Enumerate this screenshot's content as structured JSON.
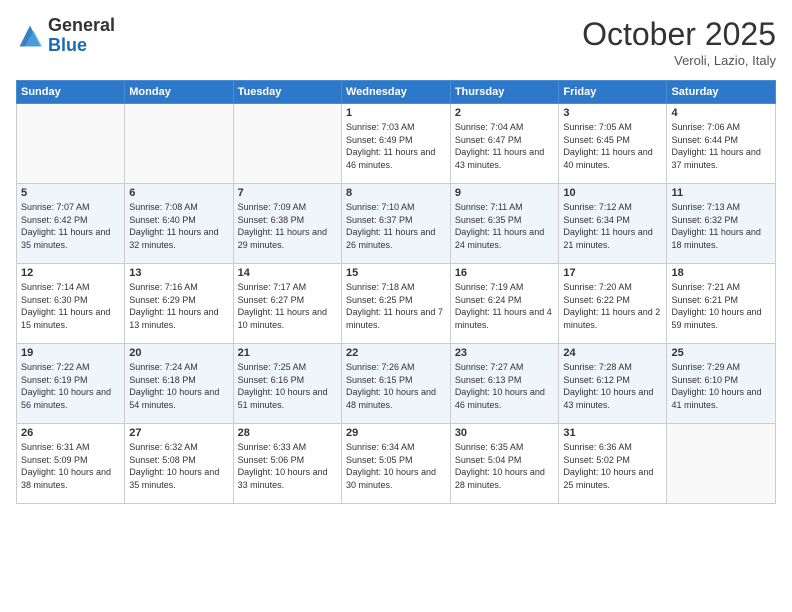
{
  "header": {
    "logo_general": "General",
    "logo_blue": "Blue",
    "month_title": "October 2025",
    "subtitle": "Veroli, Lazio, Italy"
  },
  "days_of_week": [
    "Sunday",
    "Monday",
    "Tuesday",
    "Wednesday",
    "Thursday",
    "Friday",
    "Saturday"
  ],
  "weeks": [
    [
      {
        "day": "",
        "info": ""
      },
      {
        "day": "",
        "info": ""
      },
      {
        "day": "",
        "info": ""
      },
      {
        "day": "1",
        "info": "Sunrise: 7:03 AM\nSunset: 6:49 PM\nDaylight: 11 hours and 46 minutes."
      },
      {
        "day": "2",
        "info": "Sunrise: 7:04 AM\nSunset: 6:47 PM\nDaylight: 11 hours and 43 minutes."
      },
      {
        "day": "3",
        "info": "Sunrise: 7:05 AM\nSunset: 6:45 PM\nDaylight: 11 hours and 40 minutes."
      },
      {
        "day": "4",
        "info": "Sunrise: 7:06 AM\nSunset: 6:44 PM\nDaylight: 11 hours and 37 minutes."
      }
    ],
    [
      {
        "day": "5",
        "info": "Sunrise: 7:07 AM\nSunset: 6:42 PM\nDaylight: 11 hours and 35 minutes."
      },
      {
        "day": "6",
        "info": "Sunrise: 7:08 AM\nSunset: 6:40 PM\nDaylight: 11 hours and 32 minutes."
      },
      {
        "day": "7",
        "info": "Sunrise: 7:09 AM\nSunset: 6:38 PM\nDaylight: 11 hours and 29 minutes."
      },
      {
        "day": "8",
        "info": "Sunrise: 7:10 AM\nSunset: 6:37 PM\nDaylight: 11 hours and 26 minutes."
      },
      {
        "day": "9",
        "info": "Sunrise: 7:11 AM\nSunset: 6:35 PM\nDaylight: 11 hours and 24 minutes."
      },
      {
        "day": "10",
        "info": "Sunrise: 7:12 AM\nSunset: 6:34 PM\nDaylight: 11 hours and 21 minutes."
      },
      {
        "day": "11",
        "info": "Sunrise: 7:13 AM\nSunset: 6:32 PM\nDaylight: 11 hours and 18 minutes."
      }
    ],
    [
      {
        "day": "12",
        "info": "Sunrise: 7:14 AM\nSunset: 6:30 PM\nDaylight: 11 hours and 15 minutes."
      },
      {
        "day": "13",
        "info": "Sunrise: 7:16 AM\nSunset: 6:29 PM\nDaylight: 11 hours and 13 minutes."
      },
      {
        "day": "14",
        "info": "Sunrise: 7:17 AM\nSunset: 6:27 PM\nDaylight: 11 hours and 10 minutes."
      },
      {
        "day": "15",
        "info": "Sunrise: 7:18 AM\nSunset: 6:25 PM\nDaylight: 11 hours and 7 minutes."
      },
      {
        "day": "16",
        "info": "Sunrise: 7:19 AM\nSunset: 6:24 PM\nDaylight: 11 hours and 4 minutes."
      },
      {
        "day": "17",
        "info": "Sunrise: 7:20 AM\nSunset: 6:22 PM\nDaylight: 11 hours and 2 minutes."
      },
      {
        "day": "18",
        "info": "Sunrise: 7:21 AM\nSunset: 6:21 PM\nDaylight: 10 hours and 59 minutes."
      }
    ],
    [
      {
        "day": "19",
        "info": "Sunrise: 7:22 AM\nSunset: 6:19 PM\nDaylight: 10 hours and 56 minutes."
      },
      {
        "day": "20",
        "info": "Sunrise: 7:24 AM\nSunset: 6:18 PM\nDaylight: 10 hours and 54 minutes."
      },
      {
        "day": "21",
        "info": "Sunrise: 7:25 AM\nSunset: 6:16 PM\nDaylight: 10 hours and 51 minutes."
      },
      {
        "day": "22",
        "info": "Sunrise: 7:26 AM\nSunset: 6:15 PM\nDaylight: 10 hours and 48 minutes."
      },
      {
        "day": "23",
        "info": "Sunrise: 7:27 AM\nSunset: 6:13 PM\nDaylight: 10 hours and 46 minutes."
      },
      {
        "day": "24",
        "info": "Sunrise: 7:28 AM\nSunset: 6:12 PM\nDaylight: 10 hours and 43 minutes."
      },
      {
        "day": "25",
        "info": "Sunrise: 7:29 AM\nSunset: 6:10 PM\nDaylight: 10 hours and 41 minutes."
      }
    ],
    [
      {
        "day": "26",
        "info": "Sunrise: 6:31 AM\nSunset: 5:09 PM\nDaylight: 10 hours and 38 minutes."
      },
      {
        "day": "27",
        "info": "Sunrise: 6:32 AM\nSunset: 5:08 PM\nDaylight: 10 hours and 35 minutes."
      },
      {
        "day": "28",
        "info": "Sunrise: 6:33 AM\nSunset: 5:06 PM\nDaylight: 10 hours and 33 minutes."
      },
      {
        "day": "29",
        "info": "Sunrise: 6:34 AM\nSunset: 5:05 PM\nDaylight: 10 hours and 30 minutes."
      },
      {
        "day": "30",
        "info": "Sunrise: 6:35 AM\nSunset: 5:04 PM\nDaylight: 10 hours and 28 minutes."
      },
      {
        "day": "31",
        "info": "Sunrise: 6:36 AM\nSunset: 5:02 PM\nDaylight: 10 hours and 25 minutes."
      },
      {
        "day": "",
        "info": ""
      }
    ]
  ]
}
